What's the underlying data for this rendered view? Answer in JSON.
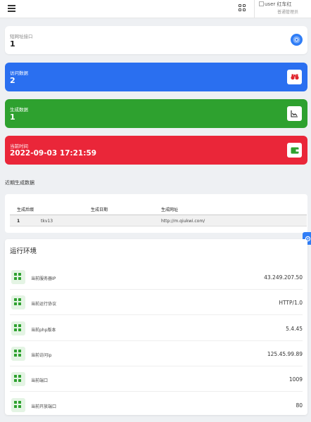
{
  "topbar": {
    "user_name": "user 红车红",
    "user_role": "普通管理员"
  },
  "cards": [
    {
      "label": "短网址接口",
      "value": "1",
      "icon": "chrome-icon",
      "color": "#ffffff"
    },
    {
      "label": "访问数据",
      "value": "2",
      "icon": "binoculars-icon",
      "color": "#2a6ff0"
    },
    {
      "label": "生成数据",
      "value": "1",
      "icon": "line-chart-icon",
      "color": "#2ea12f"
    },
    {
      "label": "当前时间",
      "value": "2022-09-03 17:21:59",
      "icon": "wallet-icon",
      "color": "#ea2639"
    }
  ],
  "recent": {
    "title": "近期生成数据",
    "columns": [
      "生成后缀",
      "生成日期",
      "生成网址"
    ],
    "rows": [
      {
        "num": "1",
        "suffix": "tkv13",
        "date": "",
        "url": "http://m.qiukwi.com/"
      }
    ]
  },
  "env": {
    "title": "运行环境",
    "rows": [
      {
        "label": "当前服务器IP",
        "value": "43.249.207.50"
      },
      {
        "label": "当前运行协议",
        "value": "HTTP/1.0"
      },
      {
        "label": "当前php版本",
        "value": "5.4.45"
      },
      {
        "label": "当前访问ip",
        "value": "125.45.99.89"
      },
      {
        "label": "当前端口",
        "value": "1009"
      },
      {
        "label": "当前开放端口",
        "value": "80"
      }
    ]
  }
}
